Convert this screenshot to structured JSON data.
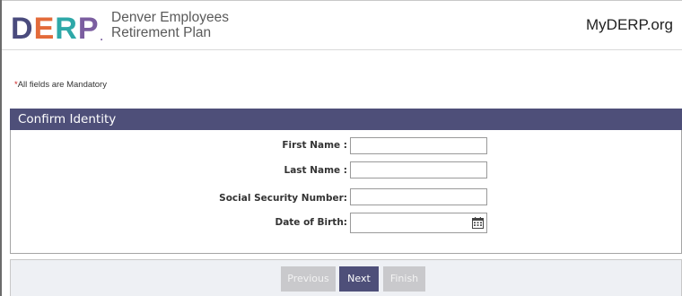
{
  "header": {
    "logo_letters": [
      "D",
      "E",
      "R",
      "P"
    ],
    "logo_colors": [
      "#4a4b7d",
      "#e36b3a",
      "#2ea8a8",
      "#7b5ea0"
    ],
    "logo_line1": "Denver Employees",
    "logo_line2": "Retirement Plan",
    "site_name": "MyDERP.org"
  },
  "notice": {
    "asterisk": "*",
    "text": "All fields are Mandatory"
  },
  "panel": {
    "title": "Confirm Identity",
    "fields": [
      {
        "label": "First Name :",
        "value": ""
      },
      {
        "label": "Last Name :",
        "value": ""
      },
      {
        "label": "Social Security Number:",
        "value": ""
      },
      {
        "label": "Date of Birth:",
        "value": "",
        "icon": "calendar-icon"
      }
    ]
  },
  "buttons": {
    "previous": "Previous",
    "next": "Next",
    "finish": "Finish"
  },
  "colors": {
    "accent": "#4e4f79",
    "disabled": "#c9c9cc",
    "footer_bg": "#eef0f4"
  }
}
